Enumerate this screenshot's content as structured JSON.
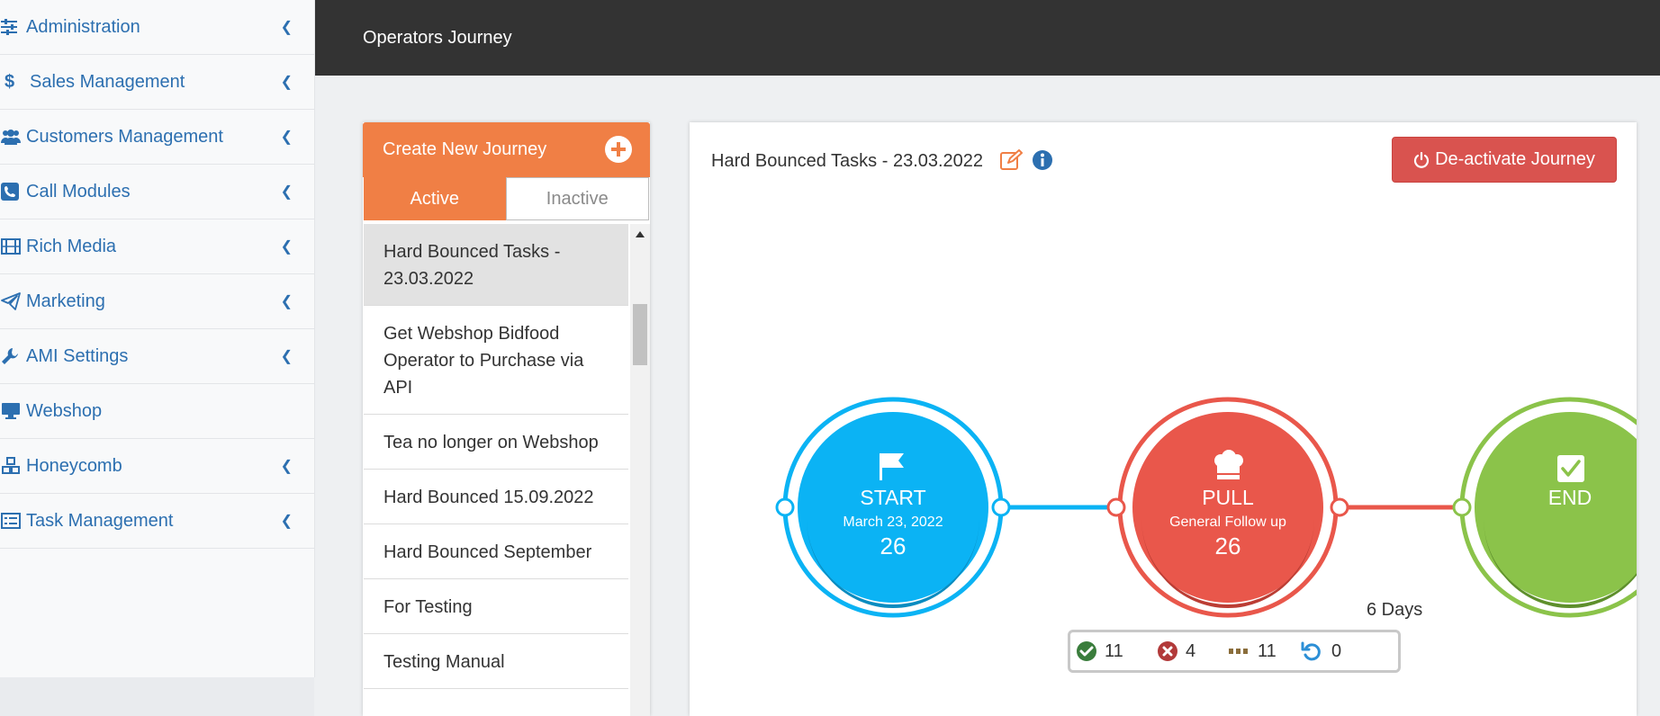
{
  "sidebar": {
    "items": [
      {
        "label": "Administration",
        "icon": "sliders-icon"
      },
      {
        "label": "Sales Management",
        "icon": "dollar-icon"
      },
      {
        "label": "Customers Management",
        "icon": "users-icon"
      },
      {
        "label": "Call Modules",
        "icon": "phone-icon"
      },
      {
        "label": "Rich Media",
        "icon": "film-icon"
      },
      {
        "label": "Marketing",
        "icon": "paper-plane-icon"
      },
      {
        "label": "AMI Settings",
        "icon": "wrench-icon"
      },
      {
        "label": "Webshop",
        "icon": "monitor-icon"
      },
      {
        "label": "Honeycomb",
        "icon": "cubes-icon"
      },
      {
        "label": "Task Management",
        "icon": "list-icon"
      }
    ]
  },
  "header": {
    "title": "Operators Journey"
  },
  "journeys": {
    "create_label": "Create New Journey",
    "tabs": {
      "active": "Active",
      "inactive": "Inactive"
    },
    "list": [
      "Hard Bounced Tasks - 23.03.2022",
      "Get Webshop Bidfood Operator to Purchase via API",
      "Tea no longer on Webshop",
      "Hard Bounced 15.09.2022",
      "Hard Bounced September",
      "For Testing",
      "Testing Manual"
    ]
  },
  "canvas": {
    "title": "Hard Bounced Tasks - 23.03.2022",
    "deactivate_label": "De-activate Journey",
    "nodes": {
      "start": {
        "title": "START",
        "subtitle": "March 23, 2022",
        "count": "26"
      },
      "pull": {
        "title": "PULL",
        "subtitle": "General Follow up",
        "count": "26"
      },
      "end": {
        "title": "END"
      }
    },
    "interval": "6 Days",
    "stats": {
      "success": "11",
      "failed": "4",
      "pending": "11",
      "retry": "0"
    }
  },
  "colors": {
    "accent": "#f07f45",
    "link": "#2c6fb0",
    "start": "#0bb3f4",
    "pull": "#e9574b",
    "end": "#8bc34a",
    "danger": "#d9534f"
  }
}
